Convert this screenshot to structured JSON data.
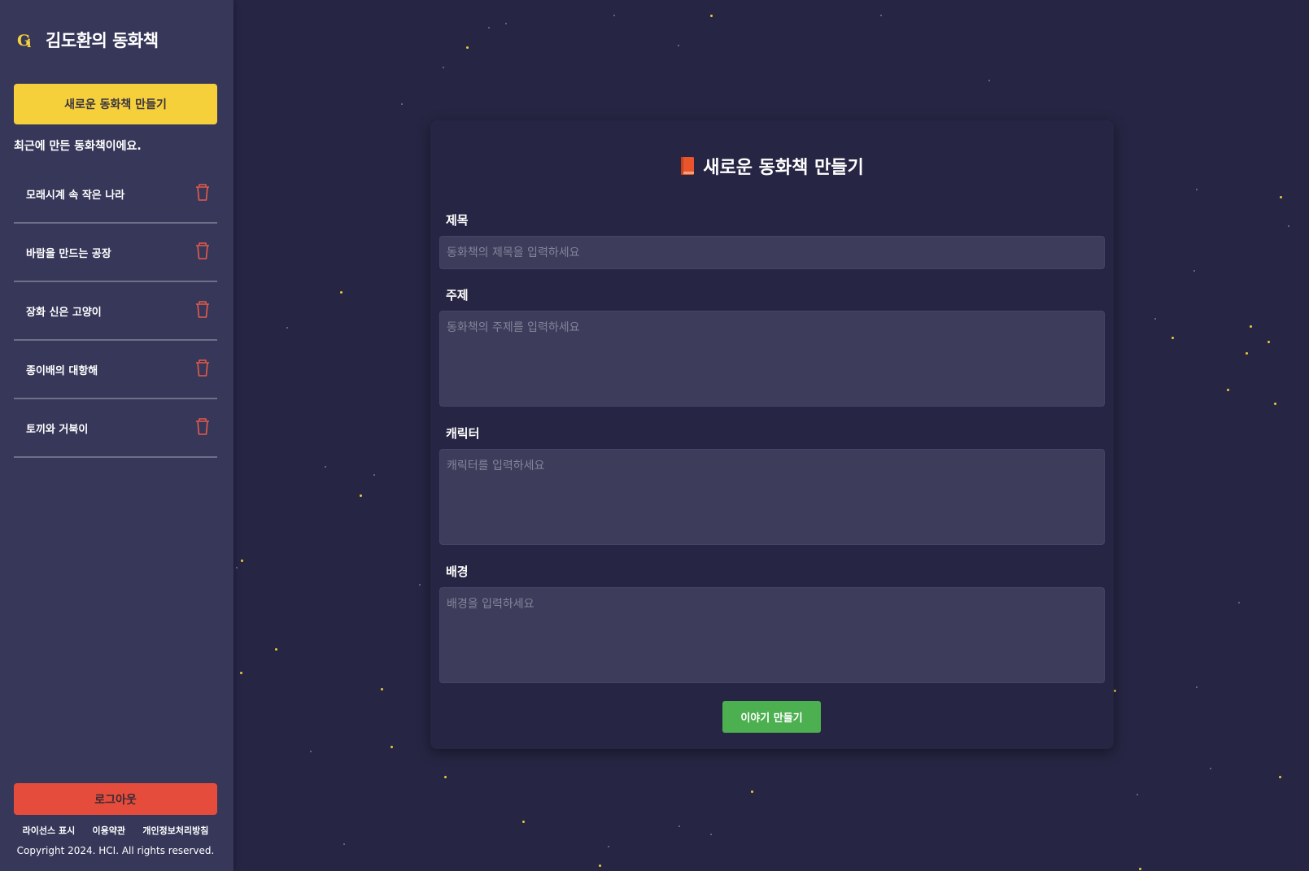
{
  "sidebar": {
    "title": "김도환의 동화책",
    "logo_icon": "gi-logo-icon",
    "new_book_label": "새로운 동화책 만들기",
    "recent_caption": "최근에 만든 동화책이에요.",
    "books": [
      {
        "title": "모래시계 속 작은 나라"
      },
      {
        "title": "바람을 만드는 공장"
      },
      {
        "title": "장화 신은 고양이"
      },
      {
        "title": "종이배의 대항해"
      },
      {
        "title": "토끼와 거북이"
      }
    ],
    "logout_label": "로그아웃",
    "footer_links": [
      "라이선스 표시",
      "이용약관",
      "개인정보처리방침"
    ],
    "copyright": "Copyright 2024. HCI. All rights reserved."
  },
  "form": {
    "title": "새로운 동화책 만들기",
    "title_icon": "book-icon",
    "fields": {
      "title": {
        "label": "제목",
        "value": "",
        "placeholder": "동화책의 제목을 입력하세요"
      },
      "theme": {
        "label": "주제",
        "value": "",
        "placeholder": "동화책의 주제를 입력하세요"
      },
      "character": {
        "label": "캐릭터",
        "value": "",
        "placeholder": "캐릭터를 입력하세요"
      },
      "background": {
        "label": "배경",
        "value": "",
        "placeholder": "배경을 입력하세요"
      }
    },
    "submit_label": "이야기 만들기"
  },
  "colors": {
    "background": "#262644",
    "sidebar": "#37375a",
    "card": "#262543",
    "accent_yellow": "#f5d03b",
    "logout_red": "#e64c3c",
    "submit_green": "#4caf50",
    "trash_red": "#e55a4a",
    "star_yellow": "#f3d23c"
  }
}
